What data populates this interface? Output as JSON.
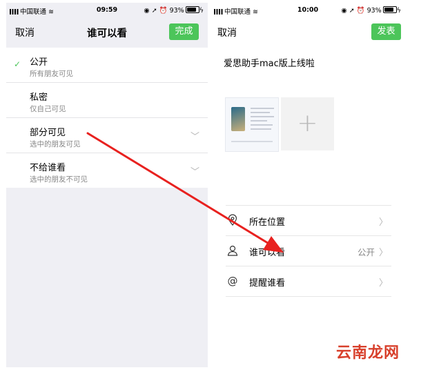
{
  "left": {
    "status": {
      "carrier": "中国联通",
      "time": "09:59",
      "battery": "93%"
    },
    "navbar": {
      "cancel": "取消",
      "title": "谁可以看",
      "done": "完成"
    },
    "options": [
      {
        "title": "公开",
        "subtitle": "所有朋友可见",
        "selected": true,
        "expandable": false
      },
      {
        "title": "私密",
        "subtitle": "仅自己可见",
        "selected": false,
        "expandable": false
      },
      {
        "title": "部分可见",
        "subtitle": "选中的朋友可见",
        "selected": false,
        "expandable": true
      },
      {
        "title": "不给谁看",
        "subtitle": "选中的朋友不可见",
        "selected": false,
        "expandable": true
      }
    ]
  },
  "right": {
    "status": {
      "carrier": "中国联通",
      "time": "10:00",
      "battery": "93%"
    },
    "navbar": {
      "cancel": "取消",
      "publish": "发表"
    },
    "post_text": "爱思助手mac版上线啦",
    "menu": [
      {
        "icon": "location-pin-icon",
        "label": "所在位置",
        "value": ""
      },
      {
        "icon": "person-icon",
        "label": "谁可以看",
        "value": "公开"
      },
      {
        "icon": "at-sign-icon",
        "label": "提醒谁看",
        "value": ""
      }
    ]
  },
  "icons": {
    "check": "checkmark-icon",
    "chevron": "chevron-right-icon",
    "add": "plus-icon"
  },
  "colors": {
    "accent_green": "#4cc55a",
    "arrow_red": "#e8211f",
    "background_gray": "#efeff4"
  },
  "watermark": "云南龙网"
}
